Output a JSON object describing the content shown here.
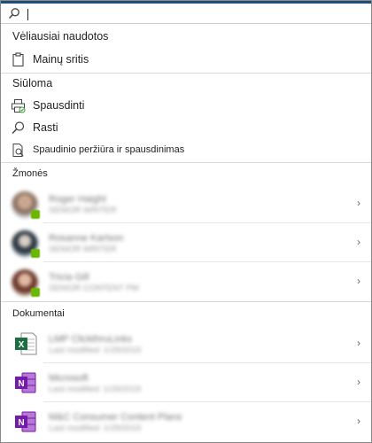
{
  "search": {
    "value": "",
    "placeholder": ""
  },
  "recent": {
    "title": "Vėliausiai naudotos",
    "items": [
      {
        "label": "Mainų sritis",
        "icon": "clipboard-icon"
      }
    ]
  },
  "suggested": {
    "title": "Siūloma",
    "items": [
      {
        "label": "Spausdinti",
        "icon": "printer-icon"
      },
      {
        "label": "Rasti",
        "icon": "search-icon"
      },
      {
        "label": "Spaudinio peržiūra ir spausdinimas",
        "icon": "print-preview-icon"
      }
    ]
  },
  "people": {
    "title": "Žmonės",
    "items": [
      {
        "name": "Roger Haight",
        "detail": "SENIOR WRITER"
      },
      {
        "name": "Rosanne Karlson",
        "detail": "SENIOR WRITER"
      },
      {
        "name": "Tricia Gill",
        "detail": "SENIOR CONTENT PM"
      }
    ]
  },
  "documents": {
    "title": "Dokumentai",
    "items": [
      {
        "name": "LMP ClickthruLinks",
        "modified": "Last modified: 1/29/2019",
        "icon": "excel-icon"
      },
      {
        "name": "Microsoft",
        "modified": "Last modified: 1/29/2019",
        "icon": "onenote-icon"
      },
      {
        "name": "M&C Consumer Content Plans",
        "modified": "Last modified: 1/29/2019",
        "icon": "onenote-icon"
      }
    ]
  },
  "colors": {
    "excel": "#1d6f42",
    "onenote": "#7719aa",
    "presence": "#6bb700",
    "topline": "#1f4e79"
  }
}
